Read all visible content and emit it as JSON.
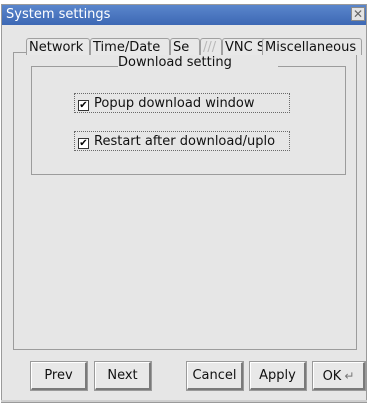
{
  "window": {
    "title": "System settings",
    "close_glyph": "✕"
  },
  "tabs": [
    {
      "label": "Network",
      "active": false
    },
    {
      "label": "Time/Date",
      "active": false
    },
    {
      "label": "Se",
      "active": false
    },
    {
      "label": "///",
      "active": false
    },
    {
      "label": "VNC S",
      "active": false
    },
    {
      "label": "Miscellaneous",
      "active": true
    }
  ],
  "download_group": {
    "title": "Download setting",
    "options": [
      {
        "label": "Popup download window",
        "checked": true
      },
      {
        "label": "Restart after download/uplo",
        "checked": true
      }
    ]
  },
  "buttons": {
    "prev": "Prev",
    "next": "Next",
    "cancel": "Cancel",
    "apply": "Apply",
    "ok": "OK"
  },
  "icons": {
    "close": "close-icon",
    "checkbox": "checkbox-checked-icon",
    "enter": "enter-key-icon"
  }
}
